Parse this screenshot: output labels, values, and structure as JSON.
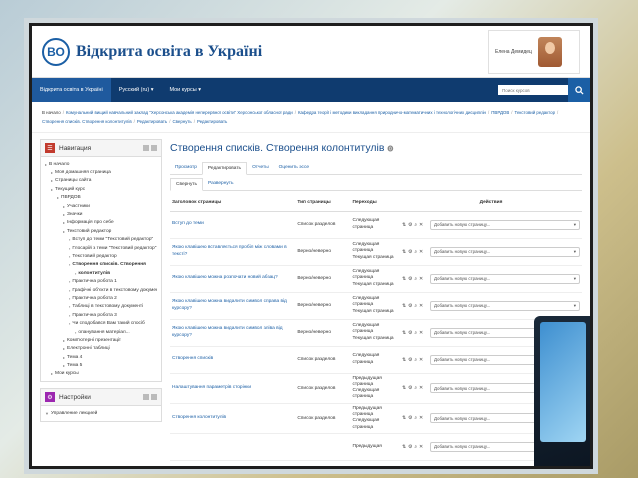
{
  "site": {
    "name": "Відкрита освіта в Україні",
    "logo_letters": "ВО"
  },
  "user": {
    "name": "Елена Демидец"
  },
  "nav": {
    "items": [
      "Відкрита освіта в Україні",
      "Русский (ru) ▾",
      "Мои курсы ▾"
    ],
    "search_placeholder": "Поиск курсов"
  },
  "breadcrumb": [
    "В начало",
    "Комунальний вищий навчальний заклад \"Херсонська академія неперервної освіти\" Херсонської обласної ради",
    "Кафедра теорії і методики викладання природничо-математичних і технологічних дисциплін",
    "ПВРДОВ",
    "Текстовий редактор",
    "Створення списків. Створення колонтитулів",
    "Редактировать",
    "Свернуть",
    "Редактировать"
  ],
  "navigation_block": {
    "title": "Навигация",
    "items": [
      {
        "label": "В начало",
        "indent": 0,
        "bold": false
      },
      {
        "label": "Моя домашняя страница",
        "indent": 1,
        "bold": false
      },
      {
        "label": "Страницы сайта",
        "indent": 1,
        "bold": false
      },
      {
        "label": "Текущий курс",
        "indent": 1,
        "bold": false
      },
      {
        "label": "ПВРДОВ",
        "indent": 2,
        "bold": false
      },
      {
        "label": "Участники",
        "indent": 3,
        "bold": false
      },
      {
        "label": "Значки",
        "indent": 3,
        "bold": false
      },
      {
        "label": "Інформація про себе",
        "indent": 3,
        "bold": false
      },
      {
        "label": "Текстовий редактор",
        "indent": 3,
        "bold": false
      },
      {
        "label": "Вступ до теми \"Текстовий редактор\"",
        "indent": 4,
        "bold": false
      },
      {
        "label": "Глосарій з теми \"Текстовий редактор\"",
        "indent": 4,
        "bold": false
      },
      {
        "label": "Текстовий редактор",
        "indent": 4,
        "bold": false
      },
      {
        "label": "Створення списків. Створення",
        "indent": 4,
        "bold": true
      },
      {
        "label": "колонтитулів",
        "indent": 5,
        "bold": true
      },
      {
        "label": "Практична робота 1",
        "indent": 4,
        "bold": false
      },
      {
        "label": "Графічні об'єкти в текстовому документі",
        "indent": 4,
        "bold": false
      },
      {
        "label": "Практична робота 2",
        "indent": 4,
        "bold": false
      },
      {
        "label": "Таблиці в текстовому документі",
        "indent": 4,
        "bold": false
      },
      {
        "label": "Практична робота 3",
        "indent": 4,
        "bold": false
      },
      {
        "label": "Чи сподобався Вам такий спосіб",
        "indent": 4,
        "bold": false
      },
      {
        "label": "опанування матеріал...",
        "indent": 5,
        "bold": false
      },
      {
        "label": "Комп'ютерні презентації",
        "indent": 3,
        "bold": false
      },
      {
        "label": "Електронні таблиці",
        "indent": 3,
        "bold": false
      },
      {
        "label": "Тема 4",
        "indent": 3,
        "bold": false
      },
      {
        "label": "Тема 5",
        "indent": 3,
        "bold": false
      },
      {
        "label": "Мои курсы",
        "indent": 1,
        "bold": false
      }
    ]
  },
  "settings_block": {
    "title": "Настройки",
    "items": [
      "Управление лекцией"
    ]
  },
  "page_title": "Створення списків. Створення колонтитулів",
  "tabs": [
    "Просмотр",
    "Редактировать",
    "Отчеты",
    "Оценить эссе"
  ],
  "subtabs": [
    "Свернуть",
    "Развернуть"
  ],
  "table": {
    "headers": [
      "Заголовок страницы",
      "Тип страницы",
      "Переходы",
      "Действия"
    ],
    "select_placeholder": "Добавить новую страницу...",
    "rows": [
      {
        "title": "Вступ до теми",
        "type": "Список разделов",
        "jumps": [
          "Следующая",
          "страница"
        ]
      },
      {
        "title": "Якою клавішею вставляється пробіл між словами в тексті?",
        "type": "Верно/неверно",
        "jumps": [
          "Следующая",
          "страница",
          "Текущая страница"
        ]
      },
      {
        "title": "Якою клавішею можна розпочати новий абзац?",
        "type": "Верно/неверно",
        "jumps": [
          "Следующая",
          "страница",
          "Текущая страница"
        ]
      },
      {
        "title": "Якою клавішею можна видалити символ справа від курсору?",
        "type": "Верно/неверно",
        "jumps": [
          "Следующая",
          "страница",
          "Текущая страница"
        ]
      },
      {
        "title": "Якою клавішею можна видалити символ зліва від курсору?",
        "type": "Верно/неверно",
        "jumps": [
          "Следующая",
          "страница",
          "Текущая страница"
        ]
      },
      {
        "title": "Створення списків",
        "type": "Список разделов",
        "jumps": [
          "Следующая",
          "страница"
        ]
      },
      {
        "title": "Налаштування параметрів сторінки",
        "type": "Список разделов",
        "jumps": [
          "Предыдущая",
          "страница",
          "Следующая",
          "страница"
        ]
      },
      {
        "title": "Створення колонтитулів",
        "type": "Список разделов",
        "jumps": [
          "Предыдущая",
          "страница",
          "Следующая",
          "страница"
        ]
      },
      {
        "title": "",
        "type": "",
        "jumps": [
          "Предыдущая"
        ]
      }
    ]
  }
}
